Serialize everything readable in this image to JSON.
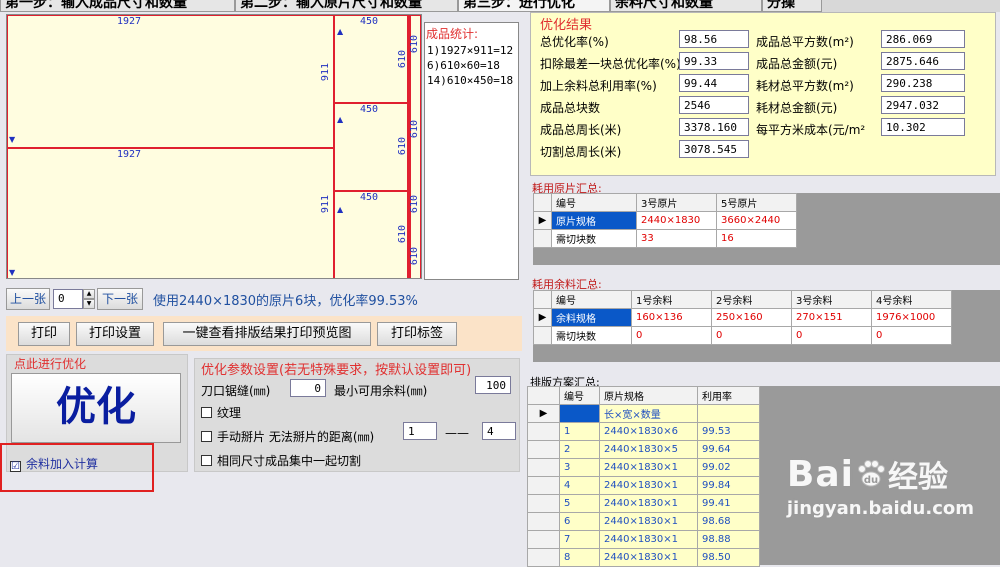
{
  "tabs": [
    "第一步：输入成品尺寸和数量",
    "第二步：输入原片尺寸和数量",
    "第三步：进行优化",
    "余料尺寸和数量",
    "分操"
  ],
  "preview": {
    "dims": {
      "top_width": "1927",
      "mid_width": "1927",
      "side_width_a": "450",
      "side_width_b": "450",
      "side_width_c": "450",
      "height_a": "911",
      "height_b": "911",
      "narrow_a": "610",
      "narrow_b": "610",
      "narrow_c": "610",
      "narrow_d": "610",
      "narrow_e": "610",
      "narrow_f": "610",
      "narrow_g": "610"
    },
    "stats_title": "成品统计:",
    "stats": [
      "1)1927×911=12",
      "6)610×60=18",
      "14)610×450=18"
    ]
  },
  "nav": {
    "prev_label": "上一张",
    "page_value": "0",
    "next_label": "下一张",
    "message": "使用2440×1830的原片6块，优化率99.53%"
  },
  "print_bar": {
    "print_label": "打印",
    "settings_label": "打印设置",
    "preview_label": "一键查看排版结果打印预览图",
    "label_label": "打印标签"
  },
  "optimize": {
    "title": "点此进行优化",
    "button_label": "优化",
    "use_remnant_label": "余料加入计算",
    "use_remnant_checked": "☑"
  },
  "params": {
    "title": "优化参数设置(若无特殊要求，按默认设置即可)",
    "kerf_label": "刀口锯缝(㎜)",
    "kerf_value": "0",
    "min_remnant_label": "最小可用余料(㎜)",
    "min_remnant_value": "100",
    "grain_label": "纹理",
    "manual_label": "手动掰片 无法掰片的距离(㎜)",
    "manual_from": "1",
    "manual_dash": "——",
    "manual_to": "4",
    "same_size_label": "相同尺寸成品集中一起切割"
  },
  "result": {
    "title": "优化结果",
    "rows": [
      {
        "l1": "总优化率(%)",
        "v1": "98.56",
        "l2": "成品总平方数(m²)",
        "v2": "286.069"
      },
      {
        "l1": "扣除最差一块总优化率(%)",
        "v1": "99.33",
        "l2": "成品总金额(元)",
        "v2": "2875.646"
      },
      {
        "l1": "加上余料总利用率(%)",
        "v1": "99.44",
        "l2": "耗材总平方数(m²)",
        "v2": "290.238"
      },
      {
        "l1": "成品总块数",
        "v1": "2546",
        "l2": "耗材总金额(元)",
        "v2": "2947.032"
      },
      {
        "l1": "成品总周长(米)",
        "v1": "3378.160",
        "l2": "每平方米成本(元/m²",
        "v2": "10.302"
      },
      {
        "l1": "切割总周长(米)",
        "v1": "3078.545",
        "l2": "",
        "v2": ""
      }
    ]
  },
  "sheets": {
    "title": "耗用原片汇总:",
    "headers": [
      "编号",
      "3号原片",
      "5号原片"
    ],
    "row1_label": "原片规格",
    "row1": [
      "2440×1830",
      "3660×2440"
    ],
    "row2_label": "需切块数",
    "row2": [
      "33",
      "16"
    ]
  },
  "remnants": {
    "title": "耗用余料汇总:",
    "headers": [
      "编号",
      "1号余料",
      "2号余料",
      "3号余料",
      "4号余料"
    ],
    "row1_label": "余料规格",
    "row1": [
      "160×136",
      "250×160",
      "270×151",
      "1976×1000"
    ],
    "row2_label": "需切块数",
    "row2": [
      "0",
      "0",
      "0",
      "0"
    ]
  },
  "plans": {
    "title": "排版方案汇总:",
    "headers": [
      "编号",
      "原片规格",
      "利用率"
    ],
    "sub_header": "长×宽×数量",
    "rows": [
      [
        "1",
        "2440×1830×6",
        "99.53"
      ],
      [
        "2",
        "2440×1830×5",
        "99.64"
      ],
      [
        "3",
        "2440×1830×1",
        "99.02"
      ],
      [
        "4",
        "2440×1830×1",
        "99.84"
      ],
      [
        "5",
        "2440×1830×1",
        "99.41"
      ],
      [
        "6",
        "2440×1830×1",
        "98.68"
      ],
      [
        "7",
        "2440×1830×1",
        "98.88"
      ],
      [
        "8",
        "2440×1830×1",
        "98.50"
      ]
    ]
  },
  "watermark": {
    "brand": "Bai",
    "brand_cn": "经验",
    "url": "jingyan.baidu.com"
  }
}
